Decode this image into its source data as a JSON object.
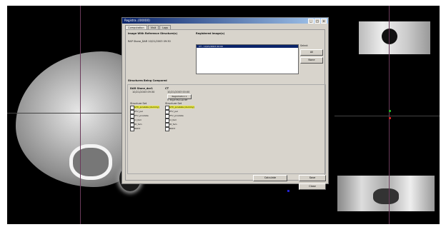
{
  "colors": {
    "desktop": "#000000",
    "dialog_bg": "#d4d0c8",
    "titlebar": "#0a246a",
    "highlight": "#e6e640"
  },
  "dialog": {
    "title": "Registra..(XXXXX)",
    "tabs": [
      "Computation",
      "Visit",
      "Logs"
    ],
    "image_ref_label": "Image With Reference Structure(s)",
    "image_ref_value": "RAP Stone_DAR 10/21/2003 09:30",
    "registered_label": "Registered Image(s)",
    "registered_item": "CT - 10/21/2003 00:00",
    "select_label": "Select",
    "btn_all": "All",
    "btn_none": "None",
    "structures_label": "Structures Being Compared",
    "left_col": {
      "header": "DAR Stone_dar1",
      "sub": "10/21/2003 09:30",
      "list_header": "Structure Set",
      "items": [
        {
          "label": "GTV_prostate (dummy)",
          "highlight": true
        },
        {
          "label": "PTV_pel",
          "highlight": false
        },
        {
          "label": "PTV_prostate",
          "highlight": false
        },
        {
          "label": "Lt_fem",
          "highlight": false
        },
        {
          "label": "Rt_fem",
          "highlight": false
        },
        {
          "label": "BODY",
          "highlight": false
        }
      ]
    },
    "right_col": {
      "header": "CT",
      "sub": "10/21/2003 00:00",
      "registration_btn": "Registration 1",
      "reg_sub": "1: Rigid Manual RE",
      "list_header": "Structure Set",
      "items": [
        {
          "label": "GTV_prostate (dummy)",
          "highlight": true
        },
        {
          "label": "PTV_pel",
          "highlight": false
        },
        {
          "label": "PTV_prostate",
          "highlight": false
        },
        {
          "label": "Lt_fem",
          "highlight": false
        },
        {
          "label": "Rt_fem",
          "highlight": false
        },
        {
          "label": "BODY",
          "highlight": false
        }
      ]
    },
    "btn_calculate": "Calculate",
    "btn_save": "Save",
    "btn_close": "Close"
  }
}
